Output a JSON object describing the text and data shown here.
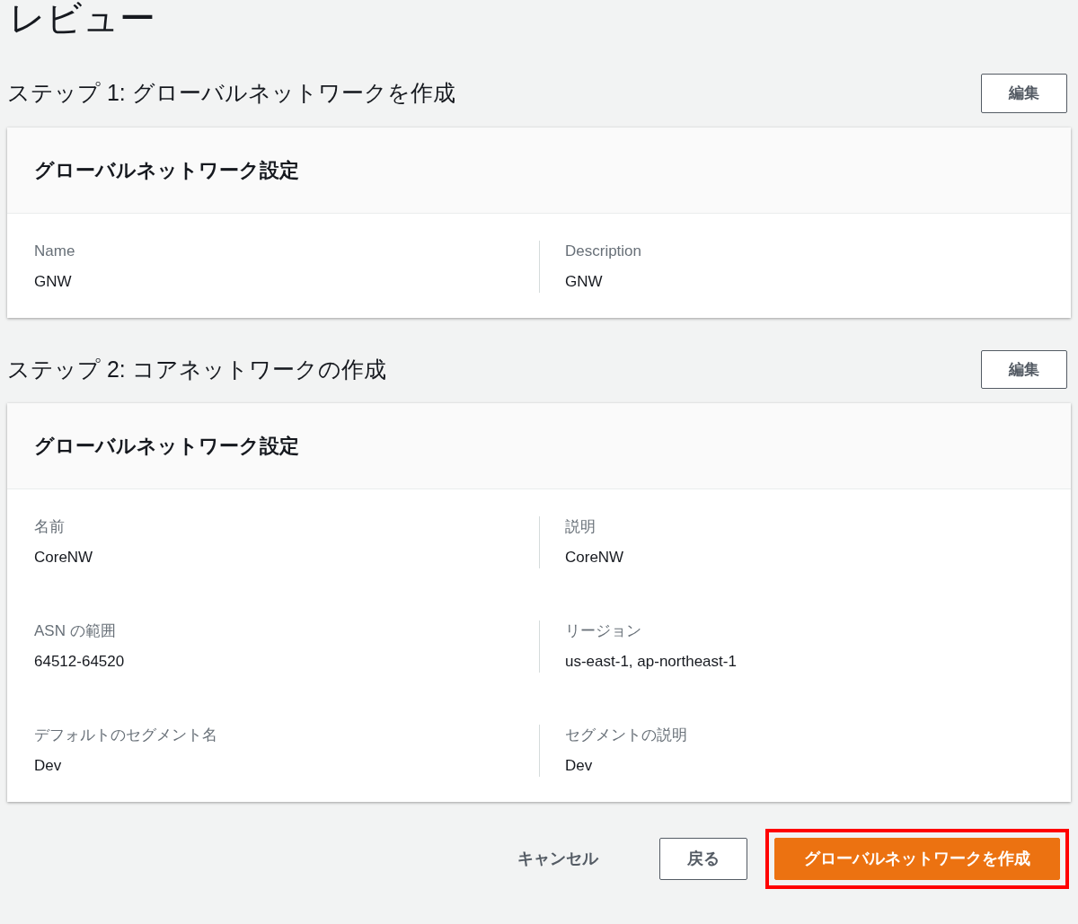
{
  "page_title": "レビュー",
  "steps": [
    {
      "title": "ステップ 1: グローバルネットワークを作成",
      "edit_button": "編集",
      "card_title": "グローバルネットワーク設定",
      "fields": [
        {
          "label": "Name",
          "value": "GNW"
        },
        {
          "label": "Description",
          "value": "GNW"
        }
      ]
    },
    {
      "title": "ステップ 2: コアネットワークの作成",
      "edit_button": "編集",
      "card_title": "グローバルネットワーク設定",
      "fields": [
        {
          "label": "名前",
          "value": "CoreNW"
        },
        {
          "label": "説明",
          "value": "CoreNW"
        },
        {
          "label": "ASN の範囲",
          "value": "64512-64520"
        },
        {
          "label": "リージョン",
          "value": "us-east-1, ap-northeast-1"
        },
        {
          "label": "デフォルトのセグメント名",
          "value": "Dev"
        },
        {
          "label": "セグメントの説明",
          "value": "Dev"
        }
      ]
    }
  ],
  "actions": [
    {
      "kind": "link",
      "label": "キャンセル",
      "highlighted": false
    },
    {
      "kind": "secondary",
      "label": "戻る",
      "highlighted": false
    },
    {
      "kind": "primary",
      "label": "グローバルネットワークを作成",
      "highlighted": true
    }
  ]
}
